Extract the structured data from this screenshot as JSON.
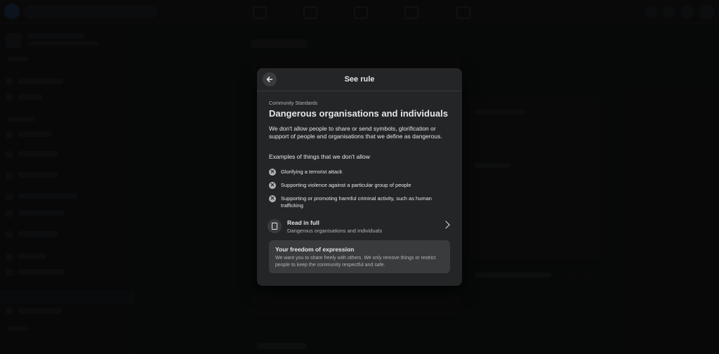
{
  "modal": {
    "title": "See rule",
    "eyebrow": "Community Standards",
    "rule_title": "Dangerous organisations and individuals",
    "description": "We don't allow people to share or send symbols, glorification or support of people and organisations that we define as dangerous.",
    "examples_heading": "Examples of things that we don't allow",
    "examples": [
      "Glorifying a terrorist attack",
      "Supporting violence against a particular group of people",
      "Supporting or promoting harmful criminal activity, such as human trafficking"
    ],
    "read_in_full": {
      "title": "Read in full",
      "subtitle": "Dangerous organisations and individuals"
    },
    "freedom": {
      "title": "Your freedom of expression",
      "text": "We want you to share freely with others. We only remove things or restrict people to keep the community respectful and safe."
    }
  },
  "icons": {
    "back": "arrow-left-icon",
    "example": "x-circle-icon",
    "read_in_full": "book-icon",
    "chevron": "chevron-right-icon"
  },
  "colors": {
    "modal_bg": "#242526",
    "card_bg": "#3a3b3c",
    "text_primary": "#e4e6eb",
    "text_secondary": "#b0b3b8"
  }
}
